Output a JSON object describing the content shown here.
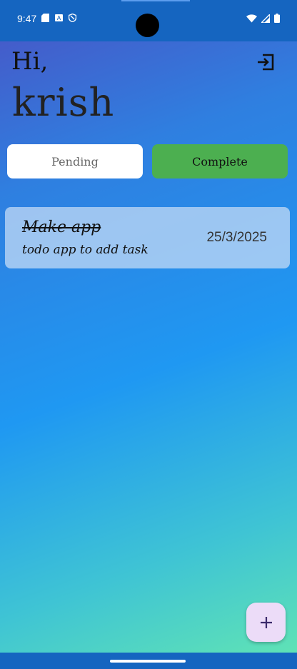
{
  "status_bar": {
    "time": "9:47",
    "left_icons": [
      "sd-card-icon",
      "keyboard-icon",
      "shield-icon"
    ],
    "right_icons": [
      "wifi-icon",
      "signal-icon",
      "battery-icon"
    ]
  },
  "header": {
    "greeting": "Hi,",
    "username": "krish",
    "logout_icon": "logout-icon"
  },
  "tabs": [
    {
      "label": "Pending",
      "selected": false,
      "color": "#ffffff"
    },
    {
      "label": "Complete",
      "selected": true,
      "color": "#4caf50"
    }
  ],
  "tasks": [
    {
      "title": "Make app",
      "description": "todo app to add task",
      "date": "25/3/2025",
      "completed": true
    }
  ],
  "fab": {
    "icon": "plus-icon",
    "color": "#ecdcf8"
  },
  "colors": {
    "status_bar": "#1565c0",
    "gradient_top": "#4a53c4",
    "gradient_bottom": "#63e6b2"
  }
}
